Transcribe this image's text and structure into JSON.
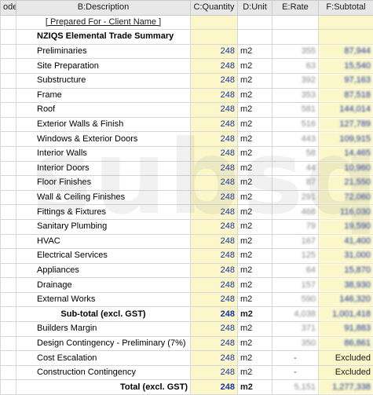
{
  "headers": {
    "a": "ode",
    "b": "B:Description",
    "c": "C:Quantity",
    "d": "D:Unit",
    "e": "E:Rate",
    "f": "F:Subtotal"
  },
  "prepared_for": "[ Prepared For - Client Name ]",
  "section_title": "NZIQS Elemental Trade Summary",
  "items": [
    {
      "desc": "Preliminaries",
      "qty": "248",
      "unit": "m2",
      "rate": "355",
      "subtotal": "87,944"
    },
    {
      "desc": "Site Preparation",
      "qty": "248",
      "unit": "m2",
      "rate": "63",
      "subtotal": "15,540"
    },
    {
      "desc": "Substructure",
      "qty": "248",
      "unit": "m2",
      "rate": "392",
      "subtotal": "97,163"
    },
    {
      "desc": "Frame",
      "qty": "248",
      "unit": "m2",
      "rate": "353",
      "subtotal": "87,518"
    },
    {
      "desc": "Roof",
      "qty": "248",
      "unit": "m2",
      "rate": "581",
      "subtotal": "144,014"
    },
    {
      "desc": "Exterior Walls & Finish",
      "qty": "248",
      "unit": "m2",
      "rate": "516",
      "subtotal": "127,789"
    },
    {
      "desc": "Windows & Exterior Doors",
      "qty": "248",
      "unit": "m2",
      "rate": "443",
      "subtotal": "109,915"
    },
    {
      "desc": "Interior Walls",
      "qty": "248",
      "unit": "m2",
      "rate": "58",
      "subtotal": "14,465"
    },
    {
      "desc": "Interior Doors",
      "qty": "248",
      "unit": "m2",
      "rate": "44",
      "subtotal": "10,960"
    },
    {
      "desc": "Floor Finishes",
      "qty": "248",
      "unit": "m2",
      "rate": "87",
      "subtotal": "21,550"
    },
    {
      "desc": "Wall & Ceiling Finishes",
      "qty": "248",
      "unit": "m2",
      "rate": "291",
      "subtotal": "72,060"
    },
    {
      "desc": "Fittings & Fixtures",
      "qty": "248",
      "unit": "m2",
      "rate": "468",
      "subtotal": "116,030"
    },
    {
      "desc": "Sanitary Plumbing",
      "qty": "248",
      "unit": "m2",
      "rate": "79",
      "subtotal": "19,590"
    },
    {
      "desc": "HVAC",
      "qty": "248",
      "unit": "m2",
      "rate": "167",
      "subtotal": "41,400"
    },
    {
      "desc": "Electrical Services",
      "qty": "248",
      "unit": "m2",
      "rate": "125",
      "subtotal": "31,000"
    },
    {
      "desc": "Appliances",
      "qty": "248",
      "unit": "m2",
      "rate": "64",
      "subtotal": "15,870"
    },
    {
      "desc": "Drainage",
      "qty": "248",
      "unit": "m2",
      "rate": "157",
      "subtotal": "38,930"
    },
    {
      "desc": "External Works",
      "qty": "248",
      "unit": "m2",
      "rate": "590",
      "subtotal": "146,320"
    }
  ],
  "subtotal_row": {
    "desc": "Sub-total (excl. GST)",
    "qty": "248",
    "unit": "m2",
    "rate": "4,038",
    "subtotal": "1,001,418"
  },
  "extras": [
    {
      "desc": "Builders Margin",
      "qty": "248",
      "unit": "m2",
      "rate": "371",
      "subtotal": "91,883"
    },
    {
      "desc": "Design Contingency - Preliminary (7%)",
      "qty": "248",
      "unit": "m2",
      "rate": "350",
      "subtotal": "86,861"
    },
    {
      "desc": "Cost Escalation",
      "qty": "248",
      "unit": "m2",
      "rate": "-",
      "subtotal": "Excluded"
    },
    {
      "desc": "Construction Contingency",
      "qty": "248",
      "unit": "m2",
      "rate": "-",
      "subtotal": "Excluded"
    }
  ],
  "total_row": {
    "desc": "Total (excl. GST)",
    "qty": "248",
    "unit": "m2",
    "rate": "5,151",
    "subtotal": "1,277,338"
  },
  "watermark": "subsqs"
}
